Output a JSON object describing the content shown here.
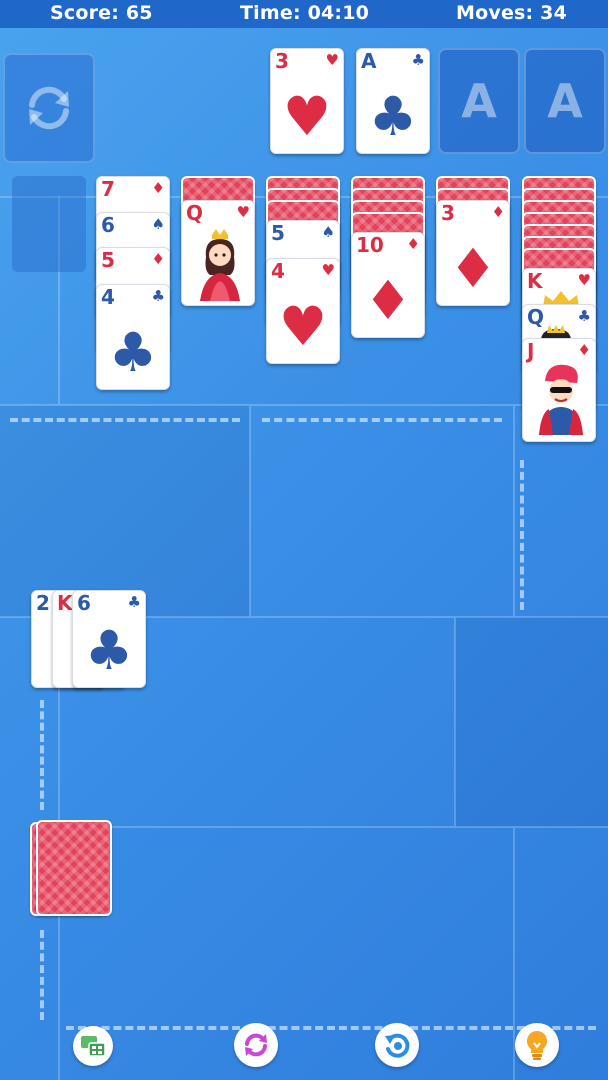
{
  "hud": {
    "score": "Score: 65",
    "time": "Time: 04:10",
    "moves": "Moves: 34"
  },
  "foundations": [
    {
      "rank": "3",
      "suit": "♥",
      "color": "red"
    },
    {
      "rank": "A",
      "suit": "♣",
      "color": "blue"
    },
    {
      "label": "A"
    },
    {
      "label": "A"
    }
  ],
  "tableau": {
    "col1": [
      {
        "rank": "7",
        "suit": "♦"
      },
      {
        "rank": "6",
        "suit": "♠"
      },
      {
        "rank": "5",
        "suit": "♦"
      },
      {
        "rank": "4",
        "suit": "♣"
      }
    ],
    "col2": {
      "top": {
        "rank": "Q",
        "suit": "♥"
      }
    },
    "col3": [
      {
        "rank": "5",
        "suit": "♠"
      },
      {
        "rank": "4",
        "suit": "♥"
      }
    ],
    "col4": {
      "top": {
        "rank": "10",
        "suit": "♦"
      }
    },
    "col5": {
      "top": {
        "rank": "3",
        "suit": "♦"
      }
    },
    "col6": [
      {
        "rank": "K",
        "suit": "♥"
      },
      {
        "rank": "Q",
        "suit": "♣"
      },
      {
        "rank": "J",
        "suit": "♦"
      }
    ]
  },
  "waste": [
    {
      "rank": "2",
      "suit": "♣"
    },
    {
      "rank": "K",
      "suit": "♥"
    },
    {
      "rank": "6",
      "suit": "♣"
    }
  ],
  "icons": {
    "recycle": "recycle-icon",
    "toolbar": [
      "layout-icon",
      "shuffle-icon",
      "undo-icon",
      "hint-bulb-icon"
    ]
  },
  "colors": {
    "red": "#dc2d45",
    "blue": "#2c59a8",
    "felt": "#3a8fe6",
    "topbar": "#1f67c9"
  }
}
